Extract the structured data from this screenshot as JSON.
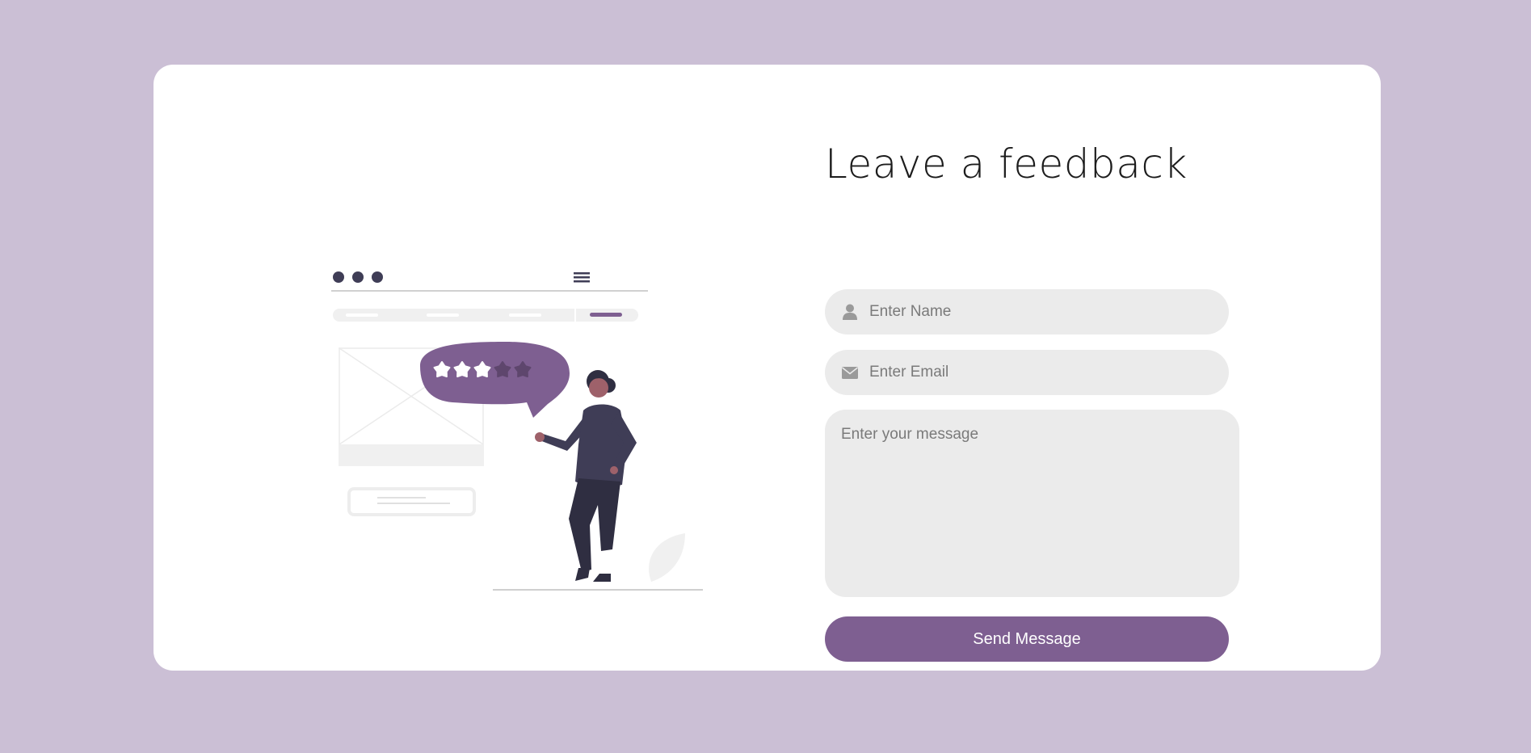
{
  "form": {
    "title": "Leave a feedback",
    "name_placeholder": "Enter Name",
    "email_placeholder": "Enter Email",
    "message_placeholder": "Enter your message",
    "submit_label": "Send Message"
  },
  "illustration": {
    "rating_stars_filled": 3,
    "rating_stars_total": 5
  },
  "icons": {
    "name_field": "user-icon",
    "email_field": "envelope-icon",
    "menu": "hamburger-menu-icon"
  },
  "colors": {
    "background": "#cbbfd5",
    "card": "#ffffff",
    "accent": "#7e5f91",
    "input_bg": "#ebebeb",
    "dark": "#3f3d56"
  }
}
